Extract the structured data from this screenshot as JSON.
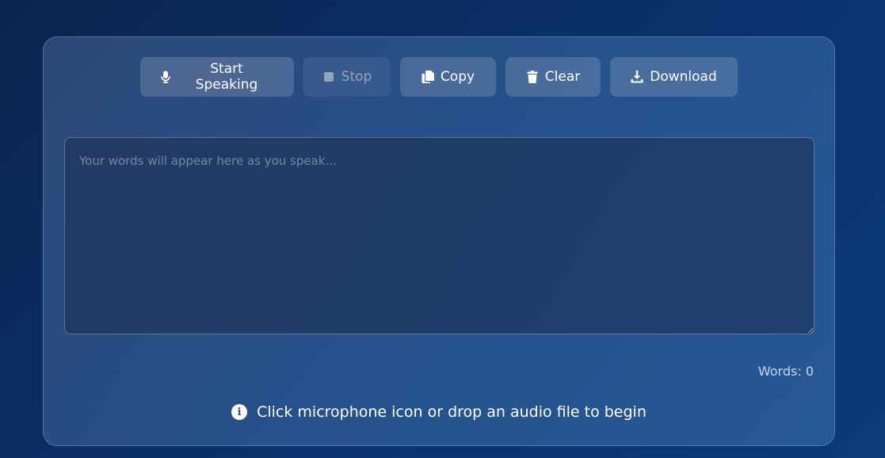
{
  "toolbar": {
    "start_label": "Start Speaking",
    "start_icon": "microphone-icon",
    "stop_label": "Stop",
    "stop_icon": "stop-icon",
    "copy_label": "Copy",
    "copy_icon": "copy-icon",
    "clear_label": "Clear",
    "clear_icon": "trash-icon",
    "download_label": "Download",
    "download_icon": "download-icon"
  },
  "transcript": {
    "value": "",
    "placeholder": "Your words will appear here as you speak..."
  },
  "stats": {
    "words_label": "Words: 0"
  },
  "hint": {
    "icon": "info-icon",
    "text": "Click microphone icon or drop an audio file to begin"
  },
  "colors": {
    "background": "#0b2d63",
    "panel": "#3c6496",
    "button": "#5a7aa6"
  }
}
